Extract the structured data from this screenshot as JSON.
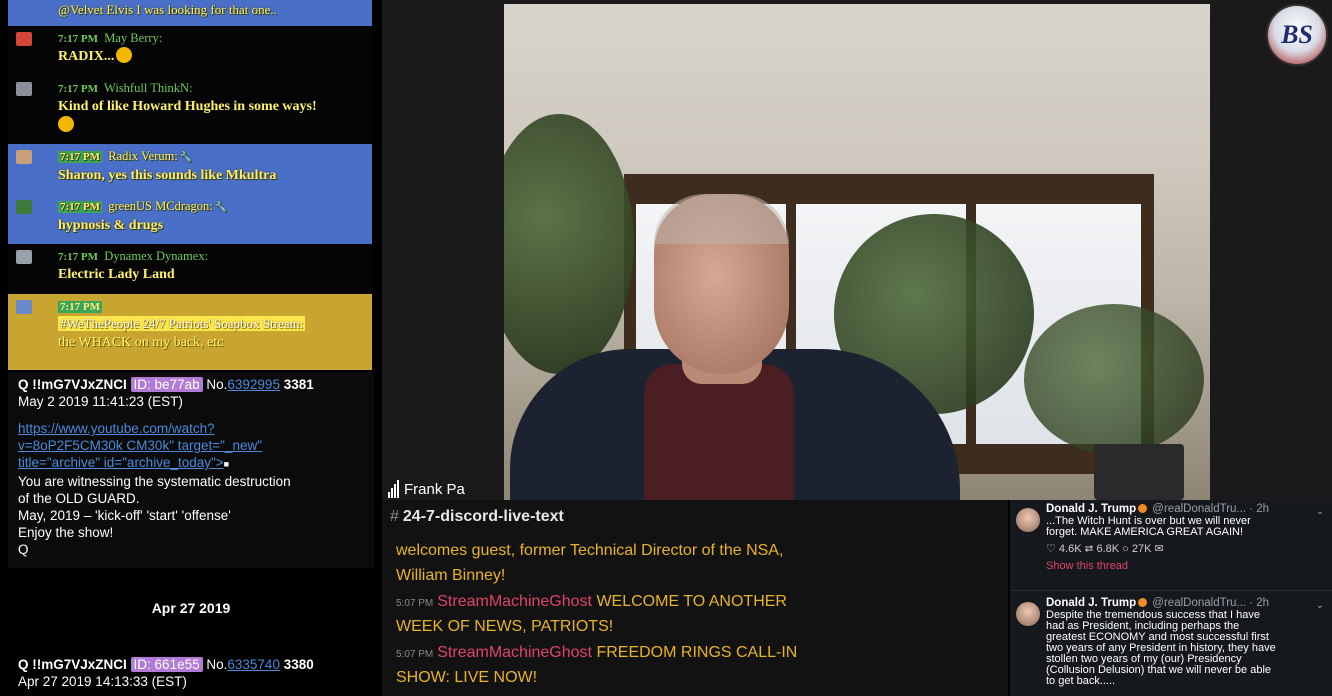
{
  "chat": {
    "top_fragment": "@Velvet Elvis I was looking for that one..",
    "messages": [
      {
        "time": "7:17 PM",
        "user": "May Berry:",
        "text": "RADIX..."
      },
      {
        "time": "7:17 PM",
        "user": "Wishfull ThinkN:",
        "text": "Kind of like Howard Hughes in some ways!"
      },
      {
        "time": "7:17 PM",
        "user": "Radix Verum:",
        "text": "Sharon, yes this sounds like Mkultra"
      },
      {
        "time": "7:17 PM",
        "user": "greenUS MCdragon:",
        "text": "hypnosis & drugs"
      },
      {
        "time": "7:17 PM",
        "user": "Dynamex Dynamex:",
        "text": "Electric Lady Land"
      },
      {
        "time": "7:17 PM",
        "tag": "#WeThePeople 24/7 Patriots' Soapbox Stream:",
        "text": "the WHACK on my back, etc"
      }
    ]
  },
  "qposts": {
    "post1": {
      "trip": "Q !!mG7VJxZNCI",
      "id": "ID: be77ab",
      "no_label": "No.",
      "no": "6392995",
      "suffix": "3381",
      "date": "May 2 2019 11:41:23 (EST)",
      "link_line1": "https://www.youtube.com/watch?",
      "link_line2": "v=8oP2F5CM30k   CM30k\" target=\"_new\"",
      "link_line3": "title=\"archive\" id=\"archive_today\">",
      "body": [
        "You are witnessing the systematic destruction",
        "of the OLD GUARD.",
        "May, 2019 – 'kick-off' 'start' 'offense'",
        "Enjoy the show!",
        "Q"
      ]
    },
    "date_divider": "Apr 27 2019",
    "post2": {
      "trip": "Q !!mG7VJxZNCI",
      "id": "ID: 661e55",
      "no_label": "No.",
      "no": "6335740",
      "suffix": "3380",
      "date": "Apr 27 2019 14:13:33 (EST)"
    }
  },
  "video": {
    "nameplate": "Frank Pa",
    "logo_text": "BS"
  },
  "discord": {
    "channel": "24-7-discord-live-text",
    "lines": [
      {
        "time": "",
        "user": "",
        "text": "welcomes guest, former Technical Director of the NSA,"
      },
      {
        "time": "",
        "user": "",
        "text": "William Binney!"
      },
      {
        "time": "5:07 PM",
        "user": "StreamMachineGhost",
        "text": "WELCOME TO ANOTHER"
      },
      {
        "time": "",
        "user": "",
        "text": "WEEK OF NEWS, PATRIOTS!"
      },
      {
        "time": "5:07 PM",
        "user": "StreamMachineGhost",
        "text": "FREEDOM RINGS CALL-IN"
      },
      {
        "time": "",
        "user": "",
        "text": "SHOW: LIVE NOW!"
      }
    ]
  },
  "twitter": {
    "tweets": [
      {
        "name": "Donald J. Trump",
        "handle": "@realDonaldTru...",
        "age": "· 2h",
        "lines": [
          "...The Witch Hunt is over but we will never",
          "forget. MAKE AMERICA GREAT AGAIN!"
        ],
        "stats": "♡ 4.6K ⮂ 6.8K ○ 27K ✉",
        "thread": "Show this thread"
      },
      {
        "name": "Donald J. Trump",
        "handle": "@realDonaldTru...",
        "age": "· 2h",
        "lines": [
          "Despite the tremendous success that I have",
          "had as President, including perhaps the",
          "greatest ECONOMY and most successful first",
          "two years of any President in history, they have",
          "stollen two years of my (our) Presidency",
          "(Collusion Delusion) that we will never be able",
          "to get back....."
        ]
      }
    ]
  },
  "colors": {
    "chat_blue": "#4a6fc9",
    "chat_gold": "#c8a430",
    "discord_gold": "#e8b423",
    "discord_user": "#e0446a",
    "q_id_tag": "#b27cd6",
    "link": "#4a8bdc"
  }
}
